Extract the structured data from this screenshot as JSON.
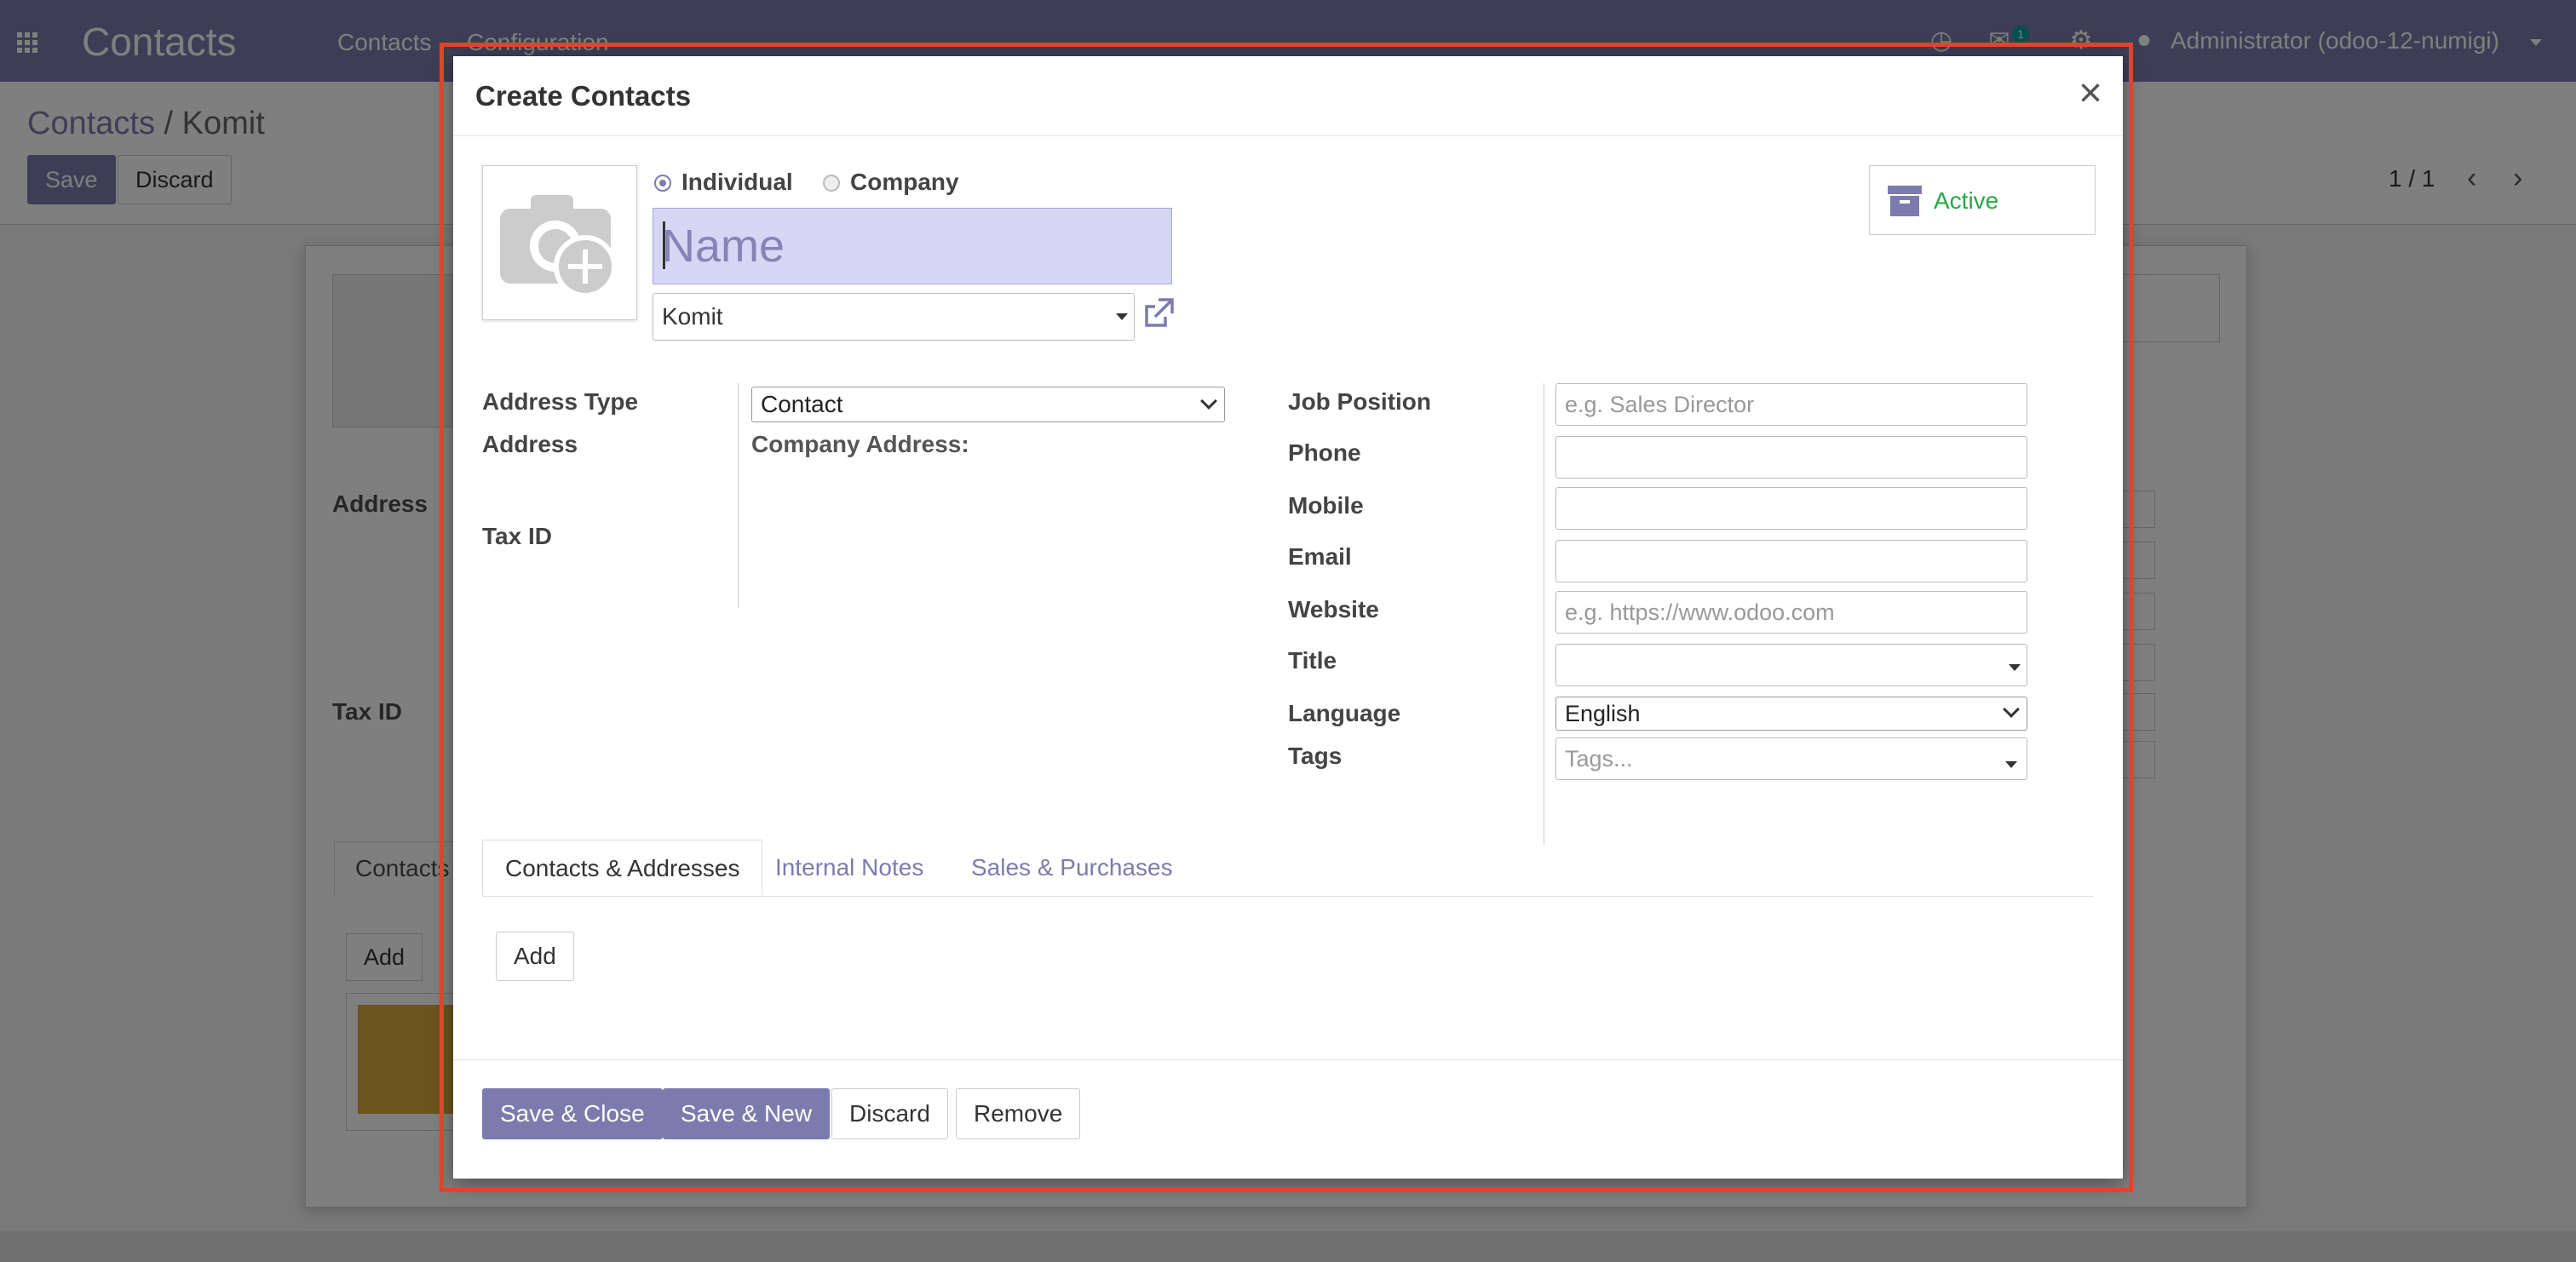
{
  "app": {
    "brand": "Contacts",
    "menu": [
      "Contacts",
      "Configuration"
    ],
    "user": "Administrator (odoo-12-numigi)",
    "message_count": "1"
  },
  "control_panel": {
    "breadcrumb_root": "Contacts",
    "breadcrumb_sep": "/",
    "breadcrumb_current": "Komit",
    "save_label": "Save",
    "discard_label": "Discard",
    "pager": "1 / 1"
  },
  "background_sheet": {
    "address_label": "Address",
    "tax_label": "Tax ID",
    "tab_label": "Contacts",
    "add_label": "Add"
  },
  "modal": {
    "title": "Create Contacts",
    "close_glyph": "×",
    "type_individual": "Individual",
    "type_company": "Company",
    "name_placeholder": "Name",
    "company_value": "Komit",
    "active_label": "Active",
    "accent_color": "#7c7bad",
    "fields_left": {
      "address_type_label": "Address Type",
      "address_type_value": "Contact",
      "address_label": "Address",
      "company_address_label": "Company Address:",
      "tax_id_label": "Tax ID"
    },
    "fields_right": {
      "job_position_label": "Job Position",
      "job_position_placeholder": "e.g. Sales Director",
      "phone_label": "Phone",
      "mobile_label": "Mobile",
      "email_label": "Email",
      "website_label": "Website",
      "website_placeholder": "e.g. https://www.odoo.com",
      "title_label": "Title",
      "language_label": "Language",
      "language_value": "English",
      "tags_label": "Tags",
      "tags_placeholder": "Tags..."
    },
    "tabs": [
      "Contacts & Addresses",
      "Internal Notes",
      "Sales & Purchases"
    ],
    "add_label": "Add",
    "footer": {
      "save_close": "Save & Close",
      "save_new": "Save & New",
      "discard": "Discard",
      "remove": "Remove"
    }
  }
}
